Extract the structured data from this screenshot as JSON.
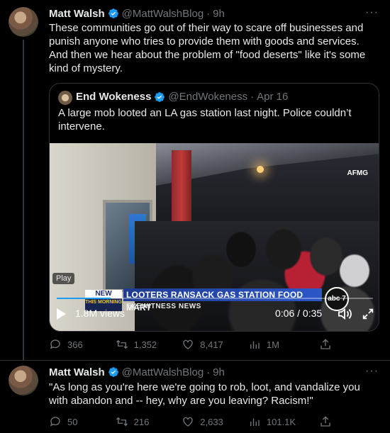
{
  "tweet1": {
    "author_name": "Matt Walsh",
    "handle": "@MattWalshBlog",
    "separator": "·",
    "time": "9h",
    "more": "···",
    "text": "These communities go out of their way to scare off businesses and punish anyone who tries to provide them with goods and services. And then we hear about the problem of \"food deserts\" like it's some kind of mystery.",
    "quote": {
      "author_name": "End Wokeness",
      "handle": "@EndWokeness",
      "separator": "·",
      "time": "Apr 16",
      "text": "A large mob looted an LA gas station last night. Police couldn’t intervene.",
      "video": {
        "watermark": "AFMG",
        "play_label": "Play",
        "lower_third": {
          "badge_top": "NEW",
          "badge_bottom": "THIS MORNING",
          "headline": "LOOTERS RANSACK GAS STATION FOOD MART",
          "subline": "EYEWITNESS NEWS",
          "logo": "abc 7"
        },
        "views": "1.8M views",
        "timer": "0:06 / 0:35",
        "progress_fraction": 0.17
      }
    },
    "actions": {
      "replies": "366",
      "reposts": "1,352",
      "likes": "8,417",
      "views": "1M"
    }
  },
  "tweet2": {
    "author_name": "Matt Walsh",
    "handle": "@MattWalshBlog",
    "separator": "·",
    "time": "9h",
    "more": "···",
    "text": "\"As long as you're here we're going to rob, loot, and vandalize you with abandon and -- hey, why are you leaving? Racism!\"",
    "actions": {
      "replies": "50",
      "reposts": "216",
      "likes": "2,633",
      "views": "101.1K"
    }
  },
  "colors": {
    "background": "#000000",
    "text": "#e7e9ea",
    "muted": "#71767b",
    "verified": "#1d9bf0",
    "border": "#2f3336"
  }
}
